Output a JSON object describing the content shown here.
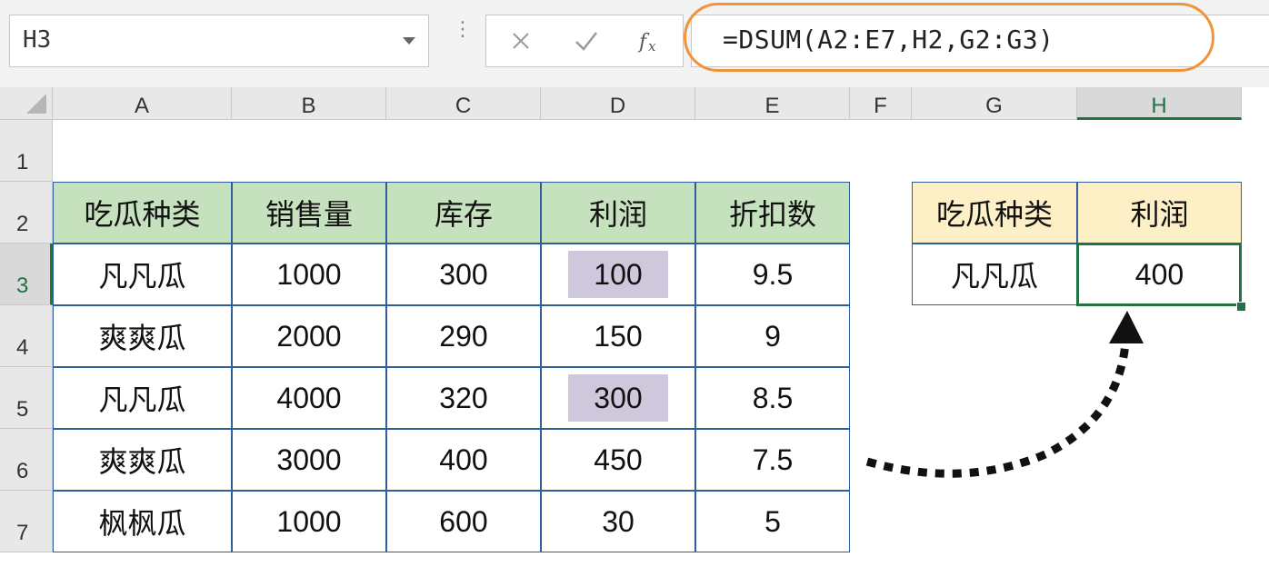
{
  "formula_bar": {
    "name_box": "H3",
    "cancel_glyph": "✕",
    "enter_glyph": "✓",
    "fx_label": "fx",
    "formula": "=DSUM(A2:E7,H2,G2:G3)"
  },
  "columns": [
    "A",
    "B",
    "C",
    "D",
    "E",
    "F",
    "G",
    "H"
  ],
  "rows": [
    "1",
    "2",
    "3",
    "4",
    "5",
    "6",
    "7"
  ],
  "main_table": {
    "headers": [
      "吃瓜种类",
      "销售量",
      "库存",
      "利润",
      "折扣数"
    ],
    "rows": [
      [
        "凡凡瓜",
        "1000",
        "300",
        "100",
        "9.5"
      ],
      [
        "爽爽瓜",
        "2000",
        "290",
        "150",
        "9"
      ],
      [
        "凡凡瓜",
        "4000",
        "320",
        "300",
        "8.5"
      ],
      [
        "爽爽瓜",
        "3000",
        "400",
        "450",
        "7.5"
      ],
      [
        "枫枫瓜",
        "1000",
        "600",
        "30",
        "5"
      ]
    ]
  },
  "criteria_table": {
    "headers": [
      "吃瓜种类",
      "利润"
    ],
    "criteria_value": "凡凡瓜",
    "result": "400"
  },
  "colors": {
    "header_green": "#c6e1bd",
    "header_yellow": "#fdf0c6",
    "highlight_purple": "#cfc8dd",
    "excel_green": "#217346",
    "callout_orange": "#f0943a"
  }
}
